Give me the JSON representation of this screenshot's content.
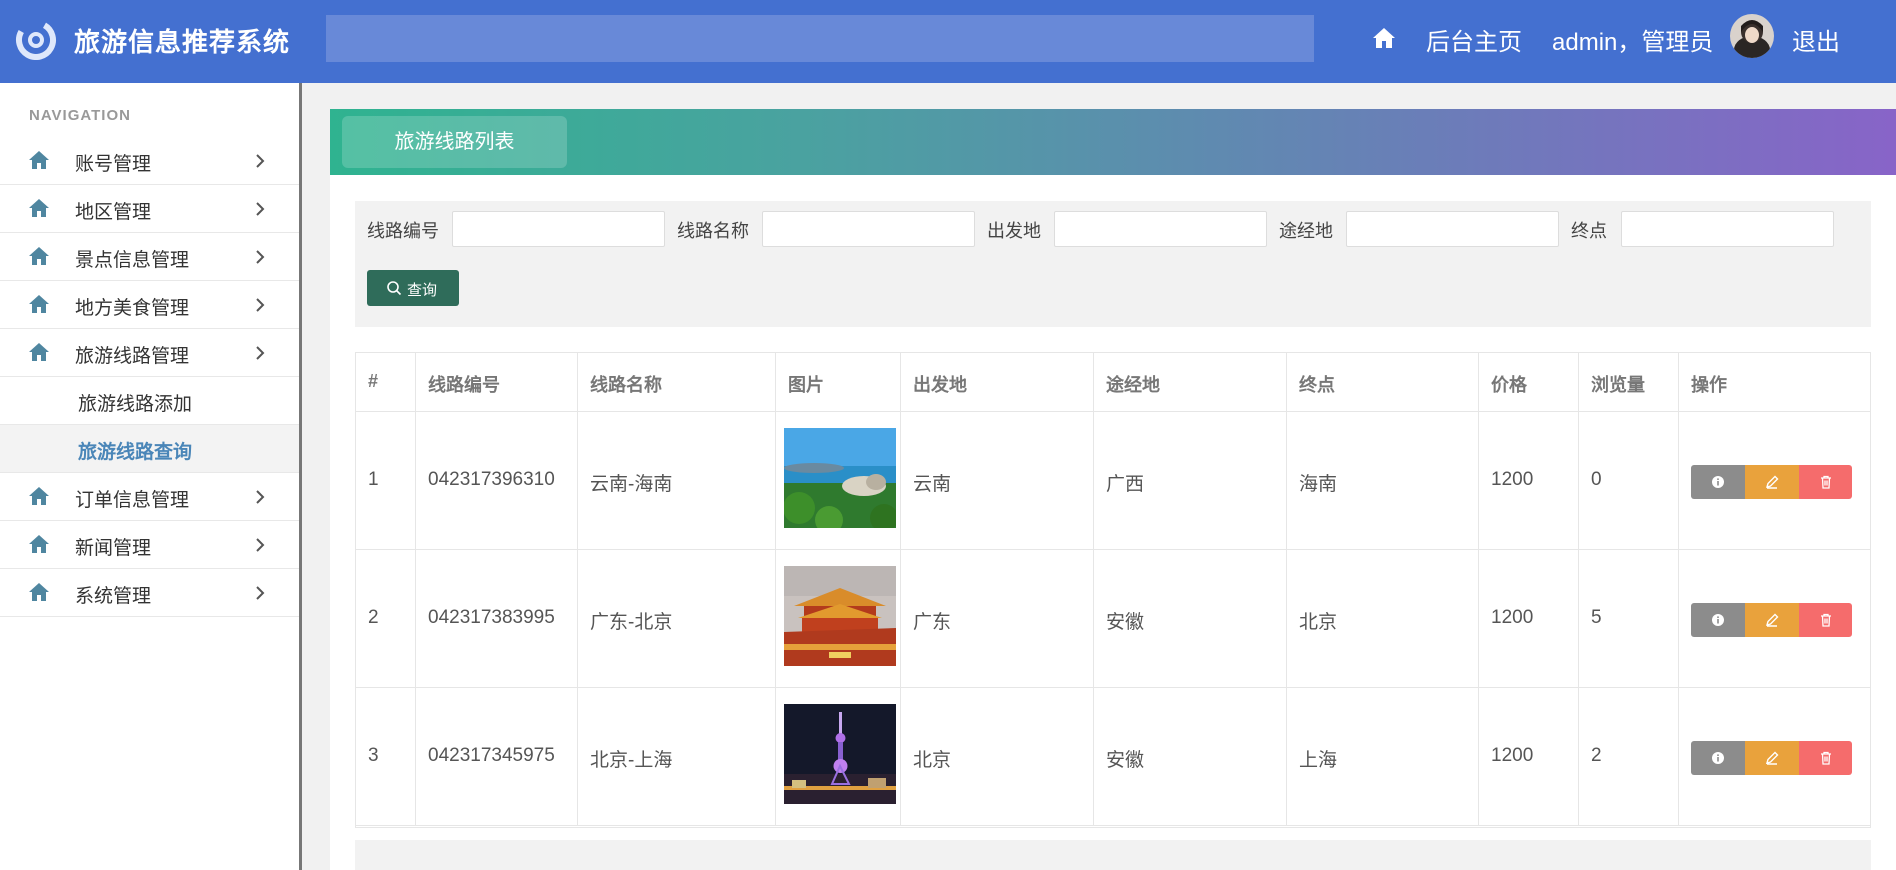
{
  "header": {
    "app_title": "旅游信息推荐系统",
    "home_link": "后台主页",
    "user_text": "admin，管理员",
    "logout": "退出",
    "accent": "#4470d0"
  },
  "sidebar": {
    "caption": "NAVIGATION",
    "items": [
      {
        "label": "账号管理",
        "icon": "home-icon"
      },
      {
        "label": "地区管理",
        "icon": "home-icon"
      },
      {
        "label": "景点信息管理",
        "icon": "home-icon"
      },
      {
        "label": "地方美食管理",
        "icon": "home-icon"
      },
      {
        "label": "旅游线路管理",
        "icon": "home-icon",
        "expanded": true
      },
      {
        "label": "订单信息管理",
        "icon": "home-icon"
      },
      {
        "label": "新闻管理",
        "icon": "home-icon"
      },
      {
        "label": "系统管理",
        "icon": "home-icon"
      }
    ],
    "subitems": [
      {
        "label": "旅游线路添加"
      },
      {
        "label": "旅游线路查询",
        "active": true
      }
    ],
    "active_color": "#4a86b8"
  },
  "panel": {
    "tab_title": "旅游线路列表"
  },
  "filter": {
    "fields": [
      {
        "label": "线路编号",
        "value": ""
      },
      {
        "label": "线路名称",
        "value": ""
      },
      {
        "label": "出发地",
        "value": ""
      },
      {
        "label": "途经地",
        "value": ""
      },
      {
        "label": "终点",
        "value": ""
      }
    ],
    "query_button": "查询"
  },
  "table": {
    "columns": [
      "#",
      "线路编号",
      "线路名称",
      "图片",
      "出发地",
      "途经地",
      "终点",
      "价格",
      "浏览量",
      "操作"
    ],
    "rows": [
      {
        "idx": "1",
        "code": "042317396310",
        "name": "云南-海南",
        "image": "beach-photo",
        "from": "云南",
        "via": "广西",
        "to": "海南",
        "price": "1200",
        "views": "0"
      },
      {
        "idx": "2",
        "code": "042317383995",
        "name": "广东-北京",
        "image": "forbidden-city-photo",
        "from": "广东",
        "via": "安徽",
        "to": "北京",
        "price": "1200",
        "views": "5"
      },
      {
        "idx": "3",
        "code": "042317345975",
        "name": "北京-上海",
        "image": "shanghai-tower-photo",
        "from": "北京",
        "via": "安徽",
        "to": "上海",
        "price": "1200",
        "views": "2"
      }
    ],
    "actions": [
      {
        "name": "info",
        "icon": "info-icon",
        "color": "#8c8c8c"
      },
      {
        "name": "edit",
        "icon": "edit-icon",
        "color": "#e9a23c"
      },
      {
        "name": "delete",
        "icon": "trash-icon",
        "color": "#f56c6c"
      }
    ]
  }
}
